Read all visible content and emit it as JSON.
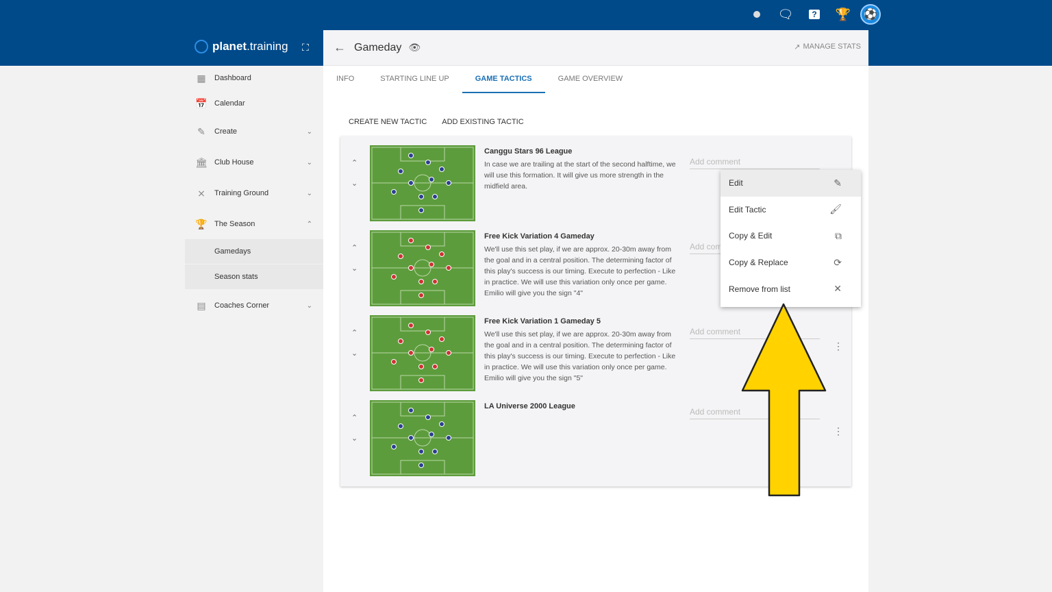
{
  "topbar": {
    "icons": [
      "status-dot-icon",
      "chat-icon",
      "help-icon",
      "trophy-icon",
      "avatar-icon"
    ]
  },
  "brand": {
    "name_bold": "planet",
    "name_rest": ".training"
  },
  "sidebar": {
    "items": [
      {
        "label": "Dashboard",
        "icon": "dashboard-icon"
      },
      {
        "label": "Calendar",
        "icon": "calendar-icon"
      },
      {
        "label": "Create",
        "icon": "pencil-icon"
      },
      {
        "label": "Club House",
        "icon": "bank-icon"
      },
      {
        "label": "Training Ground",
        "icon": "tactics-icon"
      },
      {
        "label": "The Season",
        "icon": "trophy-icon"
      },
      {
        "label": "Gamedays"
      },
      {
        "label": "Season stats"
      },
      {
        "label": "Coaches Corner",
        "icon": "couch-icon"
      }
    ]
  },
  "header": {
    "title": "Gameday",
    "manage_stats": "MANAGE STATS"
  },
  "tabs": [
    {
      "label": "INFO"
    },
    {
      "label": "STARTING LINE UP"
    },
    {
      "label": "GAME TACTICS",
      "active": true
    },
    {
      "label": "GAME OVERVIEW"
    }
  ],
  "actions": {
    "create": "CREATE NEW TACTIC",
    "add": "ADD EXISTING TACTIC"
  },
  "tactics": [
    {
      "title": "Canggu Stars 96 League",
      "description": "In case we are trailing at the start of the second halftime, we will use this formation. It will give us more strength in the midfield area.",
      "comment_placeholder": "Add comment"
    },
    {
      "title": "Free Kick Variation 4 Gameday",
      "description": "We'll use this set play, if we are approx. 20-30m away from the goal and in a central position. The determining factor of this play's success is our timing. Execute to perfection - Like in practice. We will use this variation only once per game. Emilio will give you the sign \"4\"",
      "comment_placeholder": "Add comment"
    },
    {
      "title": "Free Kick Variation 1 Gameday 5",
      "description": "We'll use this set play, if we are approx. 20-30m away from the goal and in a central position. The determining factor of this play's success is our timing. Execute to perfection - Like in practice. We will use this variation only once per game. Emilio will give you the sign \"5\"",
      "comment_placeholder": "Add comment"
    },
    {
      "title": "LA Universe 2000 League",
      "description": "",
      "comment_placeholder": "Add comment"
    }
  ],
  "context_menu": {
    "items": [
      {
        "label": "Edit",
        "icon": "pencil-icon"
      },
      {
        "label": "Edit Tactic",
        "icon": "brush-icon"
      },
      {
        "label": "Copy & Edit",
        "icon": "copy-icon"
      },
      {
        "label": "Copy & Replace",
        "icon": "sync-icon"
      },
      {
        "label": "Remove from list",
        "icon": "close-icon"
      }
    ]
  },
  "colors": {
    "brand": "#004a8a",
    "accent": "#1a6fb5",
    "arrow": "#ffd200"
  }
}
